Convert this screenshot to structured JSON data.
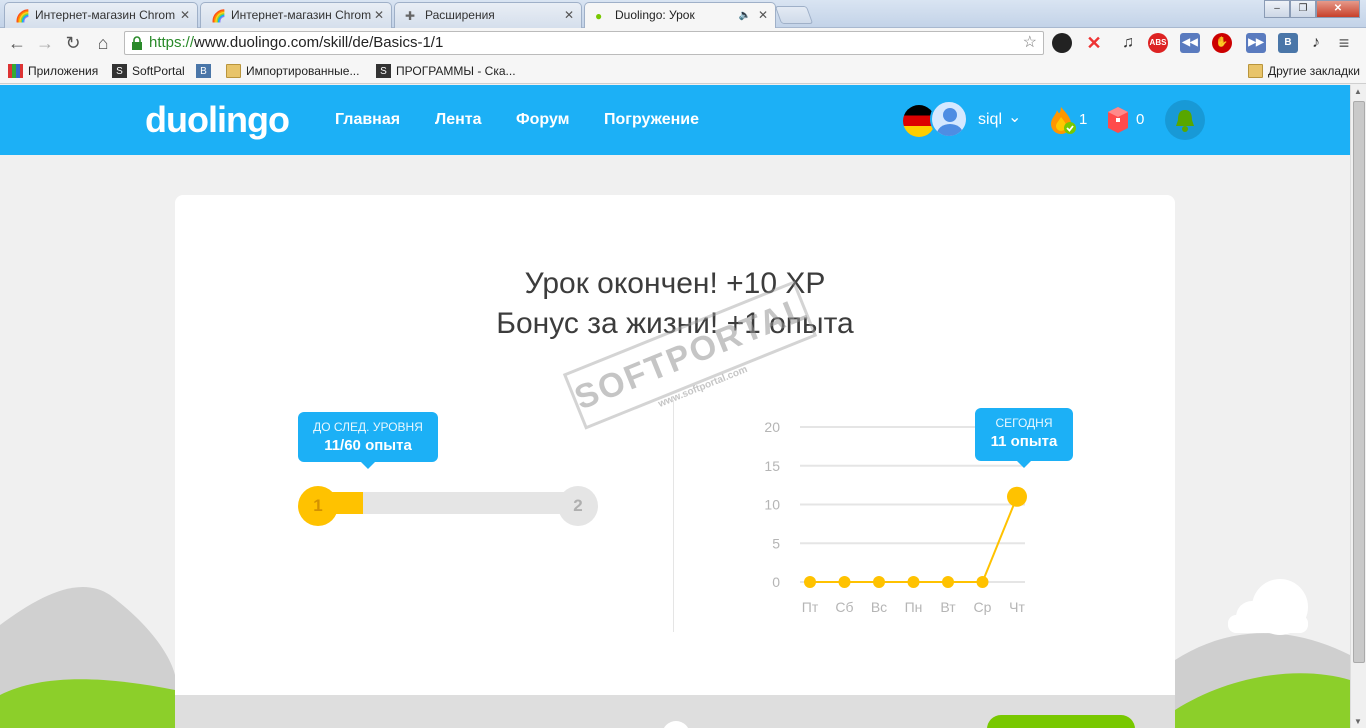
{
  "browser": {
    "tabs": [
      {
        "title": "Интернет-магазин Chrom",
        "active": false
      },
      {
        "title": "Интернет-магазин Chrom",
        "active": false
      },
      {
        "title": "Расширения",
        "active": false
      },
      {
        "title": "Duolingo: Урок",
        "active": true
      }
    ],
    "url_scheme": "https://",
    "url_rest": "www.duolingo.com/skill/de/Basics-1/1",
    "bookmarks": [
      "Приложения",
      "SoftPortal",
      "Импортированные...",
      "ПРОГРАММЫ - Ска..."
    ],
    "other_bookmarks": "Другие закладки"
  },
  "header": {
    "logo": "duolingo",
    "nav": [
      "Главная",
      "Лента",
      "Форум",
      "Погружение"
    ],
    "username": "siql",
    "streak": "1",
    "lingots": "0",
    "colors": {
      "brand": "#1cb0f6",
      "gold": "#ffc200",
      "green": "#78c800"
    }
  },
  "lesson": {
    "line1": "Урок окончен! +10 XP",
    "line2": "Бонус за жизни! +1 опыта",
    "level_tooltip_top": "ДО СЛЕД. УРОВНЯ",
    "level_tooltip_bottom": "11/60 опыта",
    "current_level": "1",
    "next_level": "2",
    "level_progress_fraction": 0.183,
    "today_tooltip_top": "СЕГОДНЯ",
    "today_tooltip_bottom": "11 опыта"
  },
  "watermark": {
    "main": "SOFTPORTAL",
    "sub": "www.softportal.com"
  },
  "chart_data": {
    "type": "line",
    "categories": [
      "Пт",
      "Сб",
      "Вс",
      "Пн",
      "Вт",
      "Ср",
      "Чт"
    ],
    "values": [
      0,
      0,
      0,
      0,
      0,
      0,
      11
    ],
    "yticks": [
      0,
      5,
      10,
      15,
      20
    ],
    "ylim": [
      0,
      20
    ],
    "grid": true,
    "color": "#ffc200"
  }
}
